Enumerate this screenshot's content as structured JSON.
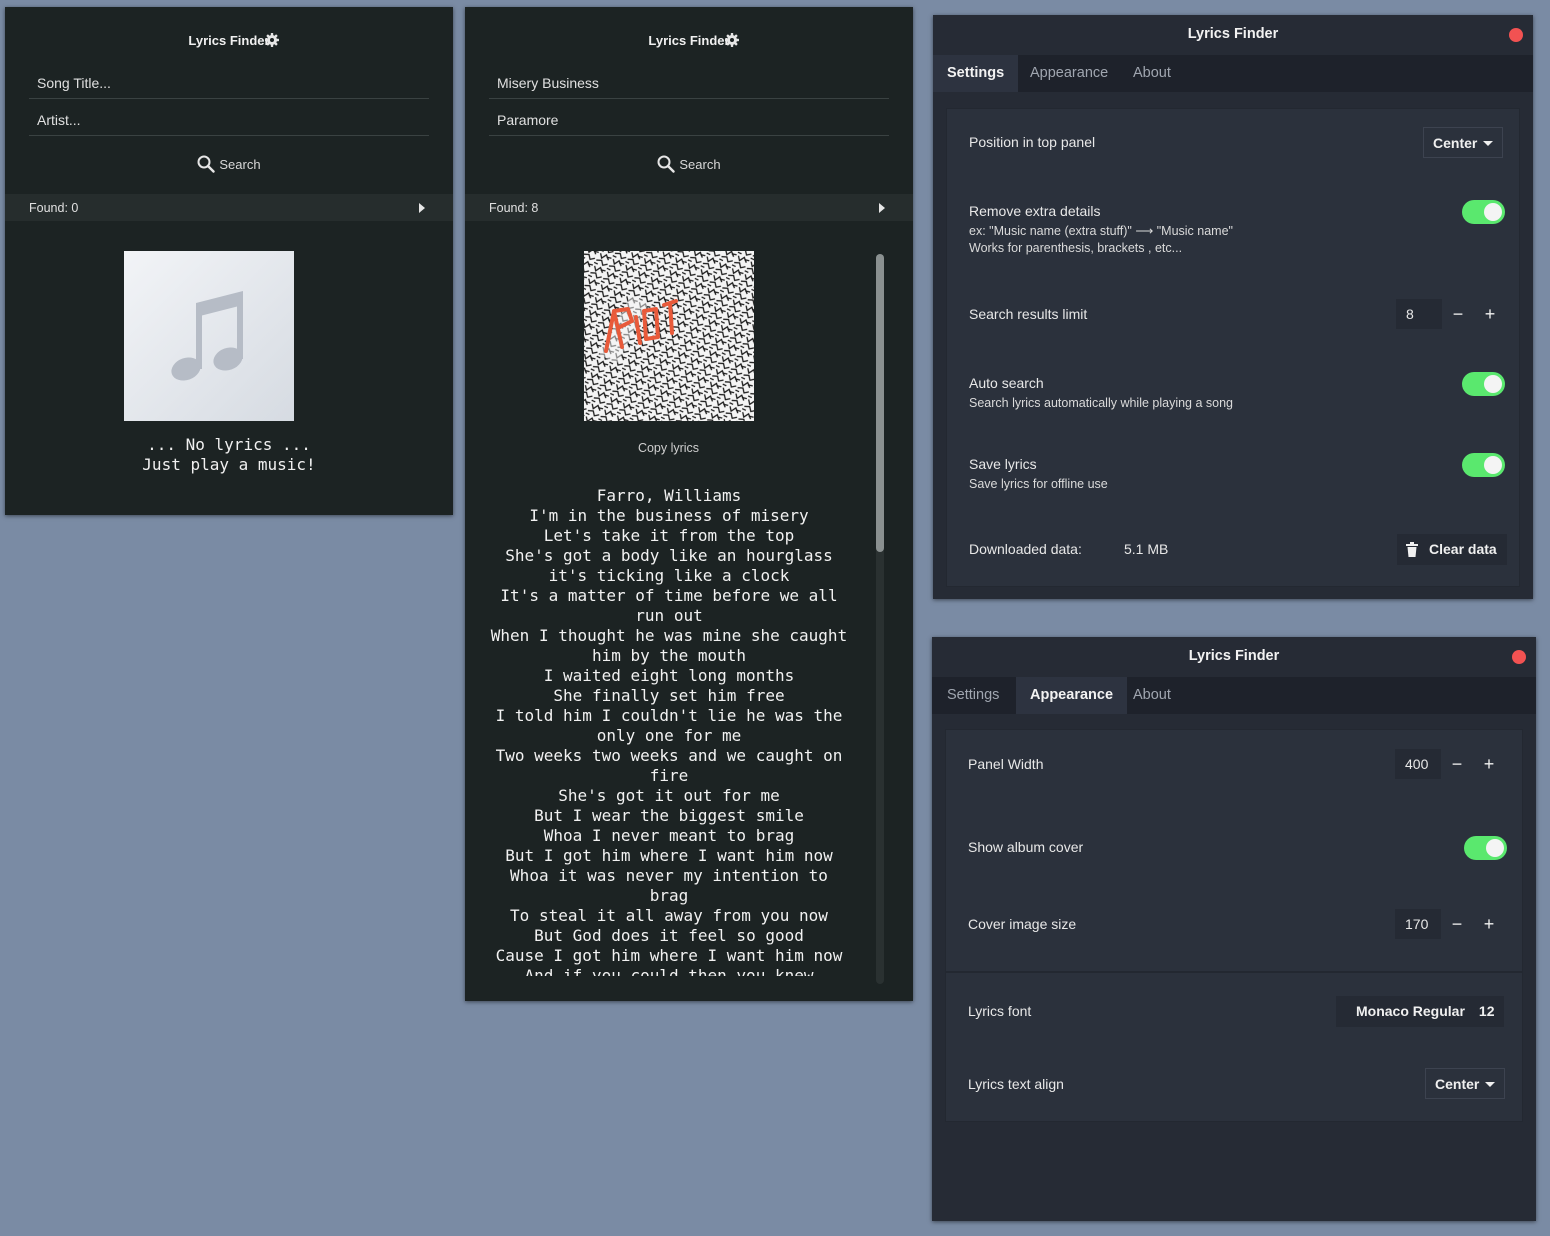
{
  "popup_empty": {
    "title": "Lyrics Finder",
    "song_placeholder": "Song Title...",
    "artist_placeholder": "Artist...",
    "search_label": "Search",
    "found_label": "Found: 0",
    "message_line1": "... No lyrics ...",
    "message_line2": "Just play a music!"
  },
  "popup_result": {
    "title": "Lyrics Finder",
    "song_value": "Misery Business",
    "artist_value": "Paramore",
    "search_label": "Search",
    "found_label": "Found: 8",
    "copy_label": "Copy lyrics",
    "lyrics": [
      "Farro, Williams",
      "I'm in the business of misery",
      "Let's take it from the top",
      "She's got a body like an hourglass",
      "it's ticking like a clock",
      "It's a matter of time before we all run out",
      "When I thought he was mine she caught him by the mouth",
      "I waited eight long months",
      "She finally set him free",
      "I told him I couldn't lie he was the only one for me",
      "Two weeks two weeks and we caught on fire",
      "She's got it out for me",
      "But I wear the biggest smile",
      "Whoa I never meant to brag",
      "But I got him where I want him now",
      "Whoa it was never my intention to brag",
      "To steal it all away from you now",
      "But God does it feel so good",
      "Cause I got him where I want him now",
      "And if you could then you knew"
    ]
  },
  "settings_window": {
    "title": "Lyrics Finder",
    "tabs": [
      "Settings",
      "Appearance",
      "About"
    ],
    "position_label": "Position in top panel",
    "position_value": "Center",
    "remove_label": "Remove extra details",
    "remove_sub1": "ex: \"Music name (extra stuff)\" ⟶ \"Music name\"",
    "remove_sub2": "Works for parenthesis, brackets , etc...",
    "limit_label": "Search results limit",
    "limit_value": "8",
    "auto_label": "Auto search",
    "auto_sub": "Search lyrics automatically while playing a song",
    "save_label": "Save lyrics",
    "save_sub": "Save lyrics for offline use",
    "downloaded_label": "Downloaded data:",
    "downloaded_value": "5.1 MB",
    "clear_label": "Clear data"
  },
  "appearance_window": {
    "title": "Lyrics Finder",
    "tabs": [
      "Settings",
      "Appearance",
      "About"
    ],
    "width_label": "Panel Width",
    "width_value": "400",
    "cover_label": "Show album cover",
    "size_label": "Cover image size",
    "size_value": "170",
    "font_label": "Lyrics font",
    "font_name": "Monaco Regular",
    "font_size": "12",
    "align_label": "Lyrics text align",
    "align_value": "Center"
  },
  "icons": {
    "gear": "gear-icon",
    "search": "search-icon",
    "arrow": "arrow-right-icon",
    "music_note": "music-note-icon",
    "trash": "trash-icon",
    "close": "close-icon",
    "album_art": "album-cover-image"
  },
  "colors": {
    "toggle_on": "#5ae86e",
    "close_button": "#f25252",
    "panel_bg": "#1c2323",
    "window_bg": "#262b35",
    "desktop_bg": "#7a8ba4"
  }
}
